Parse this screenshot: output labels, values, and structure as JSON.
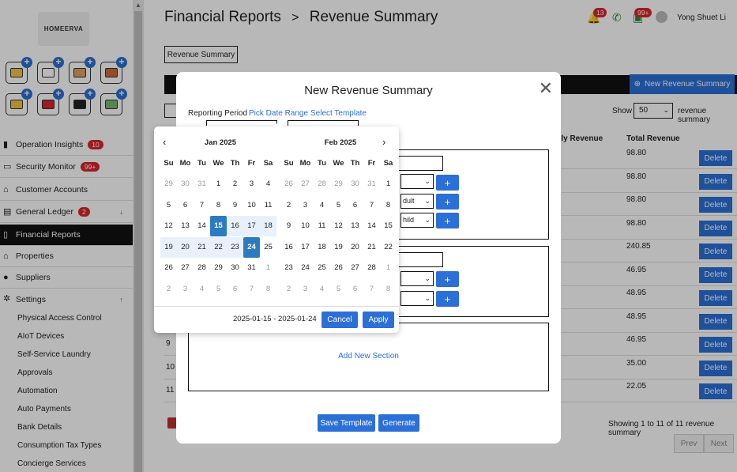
{
  "sidebar": {
    "logo": "HOMEERVA",
    "items": [
      {
        "label": "Operation Insights",
        "badge": "10"
      },
      {
        "label": "Security Monitor",
        "badge": "99+"
      },
      {
        "label": "Customer Accounts",
        "badge": ""
      },
      {
        "label": "General Ledger",
        "badge": "2"
      },
      {
        "label": "Financial Reports",
        "badge": ""
      },
      {
        "label": "Properties",
        "badge": ""
      },
      {
        "label": "Suppliers",
        "badge": ""
      },
      {
        "label": "Settings",
        "badge": ""
      }
    ],
    "sub_items": [
      "Physical Access Control",
      "AIoT Devices",
      "Self-Service Laundry",
      "Approvals",
      "Automation",
      "Auto Payments",
      "Bank Details",
      "Consumption Tax Types",
      "Concierge Services"
    ]
  },
  "header": {
    "crumb_parent": "Financial Reports",
    "separator": ">",
    "crumb_current": "Revenue Summary",
    "bell_badge": "13",
    "cart_badge": "99+",
    "user_name": "Yong Shuet Li"
  },
  "page": {
    "tab_label": "Revenue Summary",
    "new_button": "New Revenue Summary",
    "show_label": "Show",
    "show_value": "50",
    "show_suffix": "revenue summary",
    "col_daily": "aily Revenue",
    "col_total": "Total Revenue",
    "delete_label": "Delete",
    "rows": [
      {
        "num": "",
        "total": "98.80"
      },
      {
        "num": "",
        "total": "98.80"
      },
      {
        "num": "",
        "total": "98.80"
      },
      {
        "num": "",
        "total": "98.80"
      },
      {
        "num": "",
        "total": "240.85"
      },
      {
        "num": "",
        "total": "46.95"
      },
      {
        "num": "",
        "total": "48.95"
      },
      {
        "num": "",
        "total": "48.95"
      },
      {
        "num": "9",
        "total": "46.95"
      },
      {
        "num": "10",
        "total": "35.00"
      },
      {
        "num": "11",
        "total": "22.05"
      }
    ],
    "showing_text": "Showing 1 to 11 of 11 revenue summary",
    "prev": "Prev",
    "next": "Next"
  },
  "modal": {
    "title": "New Revenue Summary",
    "close": "✕",
    "reporting_period": "Reporting Period",
    "pick_date_range": "Pick Date Range",
    "select_template": "Select Template",
    "select_texts": [
      "",
      "dult",
      "hild",
      "",
      ""
    ],
    "plus": "+",
    "add_section": "Add New Section",
    "save_template": "Save Template",
    "generate": "Generate"
  },
  "picker": {
    "left_title": "Jan 2025",
    "right_title": "Feb 2025",
    "prev": "‹",
    "next": "›",
    "dow": [
      "Su",
      "Mo",
      "Tu",
      "We",
      "Th",
      "Fr",
      "Sa"
    ],
    "range_text": "2025-01-15 - 2025-01-24",
    "cancel": "Cancel",
    "apply": "Apply",
    "left_days": [
      "29",
      "30",
      "31",
      "1",
      "2",
      "3",
      "4",
      "5",
      "6",
      "7",
      "8",
      "9",
      "10",
      "11",
      "12",
      "13",
      "14",
      "15",
      "16",
      "17",
      "18",
      "19",
      "20",
      "21",
      "22",
      "23",
      "24",
      "25",
      "26",
      "27",
      "28",
      "29",
      "30",
      "31",
      "1",
      "2",
      "3",
      "4",
      "5",
      "6",
      "7",
      "8"
    ],
    "right_days": [
      "26",
      "27",
      "28",
      "29",
      "30",
      "31",
      "1",
      "2",
      "3",
      "4",
      "5",
      "6",
      "7",
      "8",
      "9",
      "10",
      "11",
      "12",
      "13",
      "14",
      "15",
      "16",
      "17",
      "18",
      "19",
      "20",
      "21",
      "22",
      "23",
      "24",
      "25",
      "26",
      "27",
      "28",
      "1",
      "2",
      "3",
      "4",
      "5",
      "6",
      "7",
      "8"
    ],
    "selected_start": "2025-01-15",
    "selected_end": "2025-01-24"
  },
  "colors": {
    "accent": "#2c6fd6",
    "badge": "#d9262c",
    "selected_day": "#2c7bc0",
    "range": "#e8f1fb"
  }
}
